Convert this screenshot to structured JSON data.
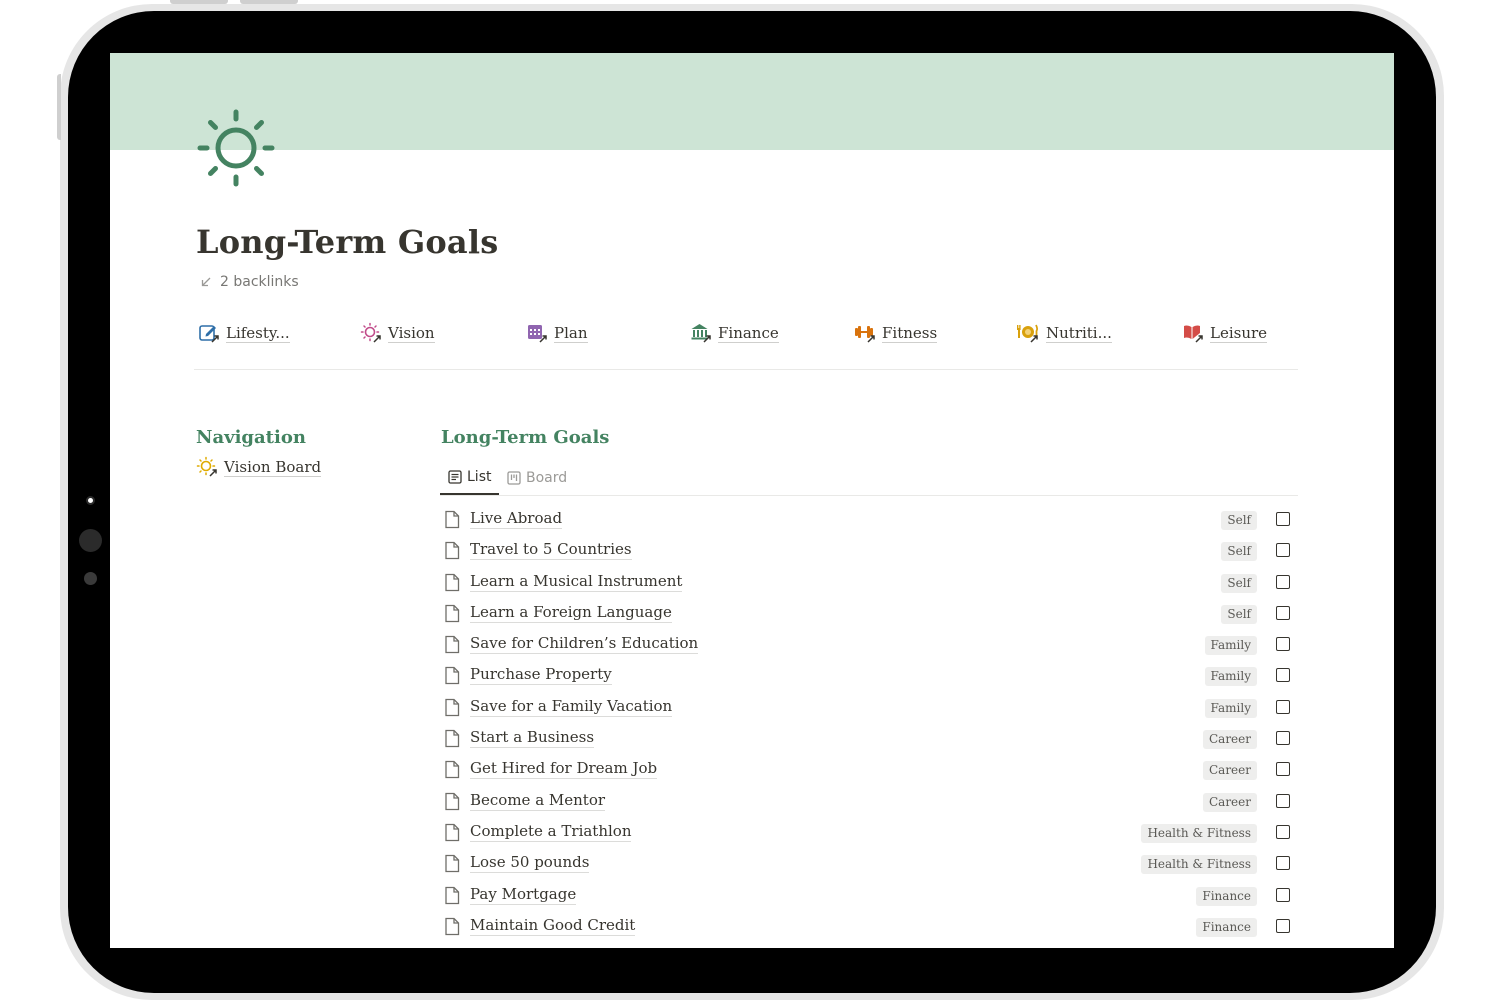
{
  "page": {
    "title": "Long-Term Goals",
    "backlinks": "2 backlinks"
  },
  "links": [
    {
      "label": "Lifesty...",
      "icon": "edit-icon",
      "color": "#2f6fa8"
    },
    {
      "label": "Vision",
      "icon": "sun-icon",
      "color": "#c14c8a"
    },
    {
      "label": "Plan",
      "icon": "calendar-icon",
      "color": "#9065b0"
    },
    {
      "label": "Finance",
      "icon": "bank-icon",
      "color": "#448361"
    },
    {
      "label": "Fitness",
      "icon": "dumbbell-icon",
      "color": "#d9730d"
    },
    {
      "label": "Nutriti...",
      "icon": "dining-icon",
      "color": "#d9a10d"
    },
    {
      "label": "Leisure",
      "icon": "book-icon",
      "color": "#d44c47"
    }
  ],
  "navigation": {
    "title": "Navigation",
    "items": [
      {
        "label": "Vision Board",
        "icon": "sun-icon",
        "color": "#dfab01"
      }
    ]
  },
  "database": {
    "title": "Long-Term Goals",
    "tabs": [
      {
        "label": "List",
        "active": true
      },
      {
        "label": "Board",
        "active": false
      }
    ],
    "rows": [
      {
        "name": "Live Abroad",
        "tag": "Self"
      },
      {
        "name": "Travel to 5 Countries",
        "tag": "Self"
      },
      {
        "name": "Learn a Musical Instrument",
        "tag": "Self"
      },
      {
        "name": "Learn a Foreign Language",
        "tag": "Self"
      },
      {
        "name": "Save for Children’s Education",
        "tag": "Family"
      },
      {
        "name": "Purchase Property",
        "tag": "Family"
      },
      {
        "name": "Save for a Family Vacation",
        "tag": "Family"
      },
      {
        "name": "Start a Business",
        "tag": "Career"
      },
      {
        "name": "Get Hired for Dream Job",
        "tag": "Career"
      },
      {
        "name": "Become a Mentor",
        "tag": "Career"
      },
      {
        "name": "Complete a Triathlon",
        "tag": "Health & Fitness"
      },
      {
        "name": "Lose 50 pounds",
        "tag": "Health & Fitness"
      },
      {
        "name": "Pay Mortgage",
        "tag": "Finance"
      },
      {
        "name": "Maintain Good Credit",
        "tag": "Finance"
      }
    ]
  },
  "colors": {
    "cover": "#cde4d5",
    "accent_green": "#448361",
    "text": "#37352f"
  }
}
